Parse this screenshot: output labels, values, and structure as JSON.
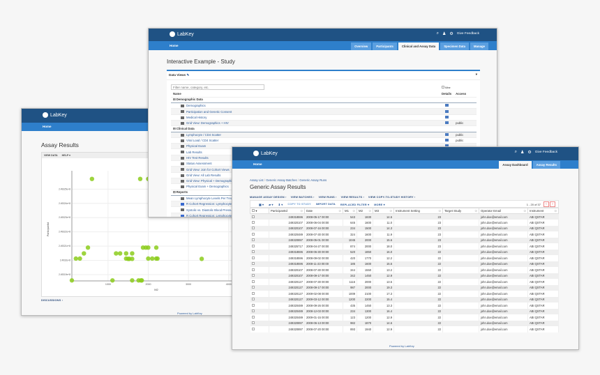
{
  "brand": "LabKey",
  "feedback": "Give Feedback",
  "home": "Home",
  "powered": "Powered by LabKey",
  "left_window": {
    "title": "Assay Results",
    "toolbar": [
      "VIEW DATA",
      "HELP ▾"
    ],
    "discussions": "DISCUSSIONS ›",
    "chart_data": {
      "type": "scatter",
      "xlabel": "M2",
      "ylabel": "ParticipantId",
      "xticks": [
        "1000",
        "2000",
        "3000",
        "4000"
      ],
      "yticks": [
        "2.49319e+8",
        "2.4932e+8",
        "2.49321e+8",
        "2.49322e+8",
        "2.49323e+8",
        "2.49324e+8",
        "2.49325e+8"
      ],
      "xlim": [
        100,
        4300
      ],
      "ylim": [
        249318560,
        249325800
      ],
      "grid": true,
      "color": "#8ccc1c",
      "points": [
        [
          600,
          249325717
        ],
        [
          1800,
          249325717
        ],
        [
          2000,
          249325717
        ],
        [
          2050,
          249325717
        ],
        [
          500,
          249320897
        ],
        [
          1870,
          249320897
        ],
        [
          1940,
          249320897
        ],
        [
          2000,
          249320897
        ],
        [
          2200,
          249320897
        ],
        [
          400,
          249320489
        ],
        [
          1200,
          249320489
        ],
        [
          1300,
          249320489
        ],
        [
          1450,
          249320489
        ],
        [
          1600,
          249320489
        ],
        [
          200,
          249320127
        ],
        [
          300,
          249320127
        ],
        [
          1450,
          249320127
        ],
        [
          1500,
          249320107
        ],
        [
          1530,
          249320107
        ],
        [
          1600,
          249320107
        ],
        [
          2000,
          249320127
        ],
        [
          2100,
          249320127
        ],
        [
          2200,
          249320127
        ],
        [
          2230,
          249320127
        ],
        [
          3330,
          249320107
        ],
        [
          100,
          249318596
        ],
        [
          1110,
          249318596
        ],
        [
          1600,
          249318596
        ],
        [
          1760,
          249318596
        ],
        [
          1820,
          249318596
        ],
        [
          1840,
          249318596
        ]
      ]
    }
  },
  "middle_window": {
    "tabs": [
      "Overview",
      "Participants",
      "Clinical and Assay Data",
      "Specimen Data",
      "Manage"
    ],
    "active_tab": "Clinical and Assay Data",
    "title": "Interactive Example - Study",
    "panel_title": "Data Views",
    "filter_placeholder": "Filter name, category, etc.",
    "mine_label": "Mine",
    "columns": [
      "Name",
      "Details",
      "Access"
    ],
    "rows": [
      {
        "type": "category",
        "name": "Demographic Data"
      },
      {
        "type": "grid",
        "name": "Demographics",
        "details": true,
        "access": ""
      },
      {
        "type": "grid",
        "name": "Participation and Genetic Consent",
        "details": true,
        "access": ""
      },
      {
        "type": "grid",
        "name": "Medical History",
        "details": true,
        "access": ""
      },
      {
        "type": "grid",
        "name": "Grid View: Demographics + HIV",
        "details": true,
        "access": "public"
      },
      {
        "type": "category",
        "name": "Clinical Data"
      },
      {
        "type": "chart",
        "name": "Lymphocyte / CD4 Scatter",
        "details": true,
        "access": "public"
      },
      {
        "type": "chart",
        "name": "Viral Load / CD4 Scatter",
        "details": true,
        "access": "public"
      },
      {
        "type": "grid",
        "name": "Physical Exam",
        "details": true,
        "access": ""
      },
      {
        "type": "grid",
        "name": "Lab Results",
        "details": false,
        "access": ""
      },
      {
        "type": "grid",
        "name": "HIV Test Results",
        "details": false,
        "access": ""
      },
      {
        "type": "grid",
        "name": "Status Assessment",
        "details": false,
        "access": ""
      },
      {
        "type": "grid",
        "name": "Grid View: Join for Cohort Views",
        "details": false,
        "access": ""
      },
      {
        "type": "grid",
        "name": "Grid View: All Lab Results",
        "details": false,
        "access": ""
      },
      {
        "type": "grid",
        "name": "Grid View: Physical + Demographics",
        "details": false,
        "access": ""
      },
      {
        "type": "grid",
        "name": "Physical Exam + Demographics",
        "details": false,
        "access": ""
      },
      {
        "type": "category",
        "name": "Reports"
      },
      {
        "type": "report",
        "name": "Mean Lymphocyte Levels Per Treatment",
        "details": false,
        "access": ""
      },
      {
        "type": "r",
        "name": "R Cohort Regression: Lymphocyte",
        "details": false,
        "access": ""
      },
      {
        "type": "chart",
        "name": "Systolic vs. Diastolic Blood Pressure",
        "details": false,
        "access": ""
      },
      {
        "type": "r",
        "name": "R Cohort Regression: Lymphocyte",
        "details": false,
        "access": ""
      }
    ]
  },
  "front_window": {
    "tabs": [
      "Assay Dashboard",
      "Assay Results"
    ],
    "active_tab": "Assay Dashboard",
    "breadcrumb": [
      "Assay List",
      "Generic Assay Batches",
      "Generic Assay Runs"
    ],
    "title": "Generic Assay Results",
    "menus": [
      "MANAGE ASSAY DESIGN ›",
      "VIEW BATCHES ›",
      "VIEW RUNS ›",
      "VIEW RESULTS ›",
      "VIEW COPY-TO-STUDY HISTORY ›"
    ],
    "toolbar": [
      "COPY TO STUDY",
      "IMPORT DATA",
      "REPLACED FILTER ▾",
      "MORE ▾"
    ],
    "pagination": "1 - 20 of 37",
    "columns": [
      "ParticipantId",
      "Date",
      "M1",
      "M2",
      "M3",
      "Instrument Setting",
      "Target Study",
      "Operator Email",
      "Instrument"
    ],
    "rows": [
      [
        "249318596",
        "2008-05-17 00:00",
        "543",
        "1830",
        "14.5",
        "23",
        "",
        "john.doe@email.com",
        "ABI QSTAR"
      ],
      [
        "249320107",
        "2008-06-04 00:00",
        "645",
        "1600",
        "11.0",
        "23",
        "",
        "john.doe@email.com",
        "ABI QSTAR"
      ],
      [
        "249320107",
        "2008-07-16 00:00",
        "234",
        "1500",
        "14.3",
        "23",
        "",
        "john.doe@email.com",
        "ABI QSTAR"
      ],
      [
        "249320489",
        "2008-07-30 00:00",
        "324",
        "1600",
        "11.9",
        "23",
        "",
        "john.doe@email.com",
        "ABI QSTAR"
      ],
      [
        "249320897",
        "2008-05-01 00:00",
        "1045",
        "2000",
        "15.6",
        "23",
        "",
        "john.doe@email.com",
        "ABI QSTAR"
      ],
      [
        "249325717",
        "2008-04-27 00:00",
        "874",
        "2000",
        "18.0",
        "23",
        "",
        "john.doe@email.com",
        "ABI QSTAR"
      ],
      [
        "249318596",
        "2008-06-30 00:00",
        "520",
        "1850",
        "16.0",
        "22",
        "",
        "john.doe@email.com",
        "ABI QSTAR"
      ],
      [
        "249318596",
        "2008-09-02 00:00",
        "420",
        "1770",
        "12.2",
        "22",
        "",
        "john.doe@email.com",
        "ABI QSTAR"
      ],
      [
        "249318596",
        "2008-11-23 00:00",
        "185",
        "1600",
        "15.5",
        "22",
        "",
        "john.doe@email.com",
        "ABI QSTAR"
      ],
      [
        "249320107",
        "2008-07-30 00:00",
        "344",
        "1550",
        "13.2",
        "22",
        "",
        "john.doe@email.com",
        "ABI QSTAR"
      ],
      [
        "249320107",
        "2008-09-17 00:00",
        "342",
        "1450",
        "12.9",
        "22",
        "",
        "john.doe@email.com",
        "ABI QSTAR"
      ],
      [
        "249320127",
        "2008-07-30 00:00",
        "1116",
        "2000",
        "13.5",
        "22",
        "",
        "john.doe@email.com",
        "ABI QSTAR"
      ],
      [
        "249320127",
        "2008-09-17 00:00",
        "987",
        "2000",
        "19.3",
        "22",
        "",
        "john.doe@email.com",
        "ABI QSTAR"
      ],
      [
        "249320127",
        "2009-02-08 00:00",
        "1009",
        "2100",
        "17.3",
        "22",
        "",
        "john.doe@email.com",
        "ABI QSTAR"
      ],
      [
        "249320127",
        "2009-03-12 00:00",
        "1200",
        "2200",
        "15.4",
        "22",
        "",
        "john.doe@email.com",
        "ABI QSTAR"
      ],
      [
        "249320489",
        "2008-09-26 00:00",
        "435",
        "1450",
        "13.3",
        "22",
        "",
        "john.doe@email.com",
        "ABI QSTAR"
      ],
      [
        "249320489",
        "2008-12-03 00:00",
        "234",
        "1300",
        "16.4",
        "22",
        "",
        "john.doe@email.com",
        "ABI QSTAR"
      ],
      [
        "249320489",
        "2009-01-15 00:00",
        "123",
        "1200",
        "12.9",
        "22",
        "",
        "john.doe@email.com",
        "ABI QSTAR"
      ],
      [
        "249320897",
        "2008-06-13 00:00",
        "982",
        "1870",
        "14.6",
        "22",
        "",
        "john.doe@email.com",
        "ABI QSTAR"
      ],
      [
        "249320897",
        "2008-07-20 00:00",
        "893",
        "1940",
        "12.9",
        "22",
        "",
        "john.doe@email.com",
        "ABI QSTAR"
      ]
    ]
  }
}
